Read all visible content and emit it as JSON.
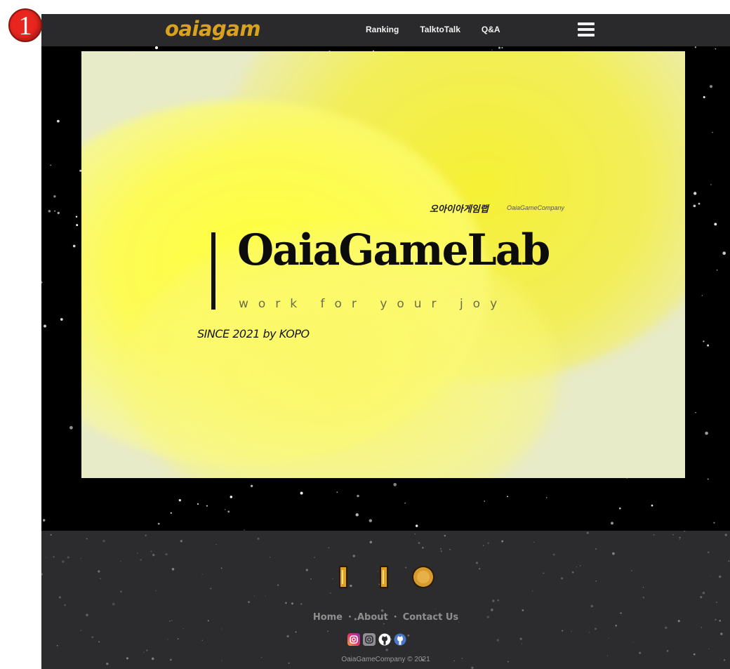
{
  "annotation": {
    "marker_number": "1"
  },
  "navbar": {
    "logo": "oaiagam",
    "links": [
      "Ranking",
      "TalktoTalk",
      "Q&A"
    ]
  },
  "hero": {
    "subtitle_ko": "오아이아게임랩",
    "subtitle_en": "OaiaGameCompany",
    "brand": "OaiaGameLab",
    "tagline": "work for your joy",
    "since": "SINCE 2021 by KOPO"
  },
  "footer": {
    "links": [
      "Home",
      "About",
      "Contact Us"
    ],
    "separator": "·",
    "social": [
      "instagram-icon",
      "instagram-icon",
      "github-icon",
      "github-icon"
    ],
    "copyright": "OaiaGameCompany © 2021"
  },
  "colors": {
    "logo": "#d8a21e",
    "navbar_bg": "#2a2a2c",
    "footer_bg": "#2c2c2e",
    "hero_yellow": "#ffff3c"
  }
}
